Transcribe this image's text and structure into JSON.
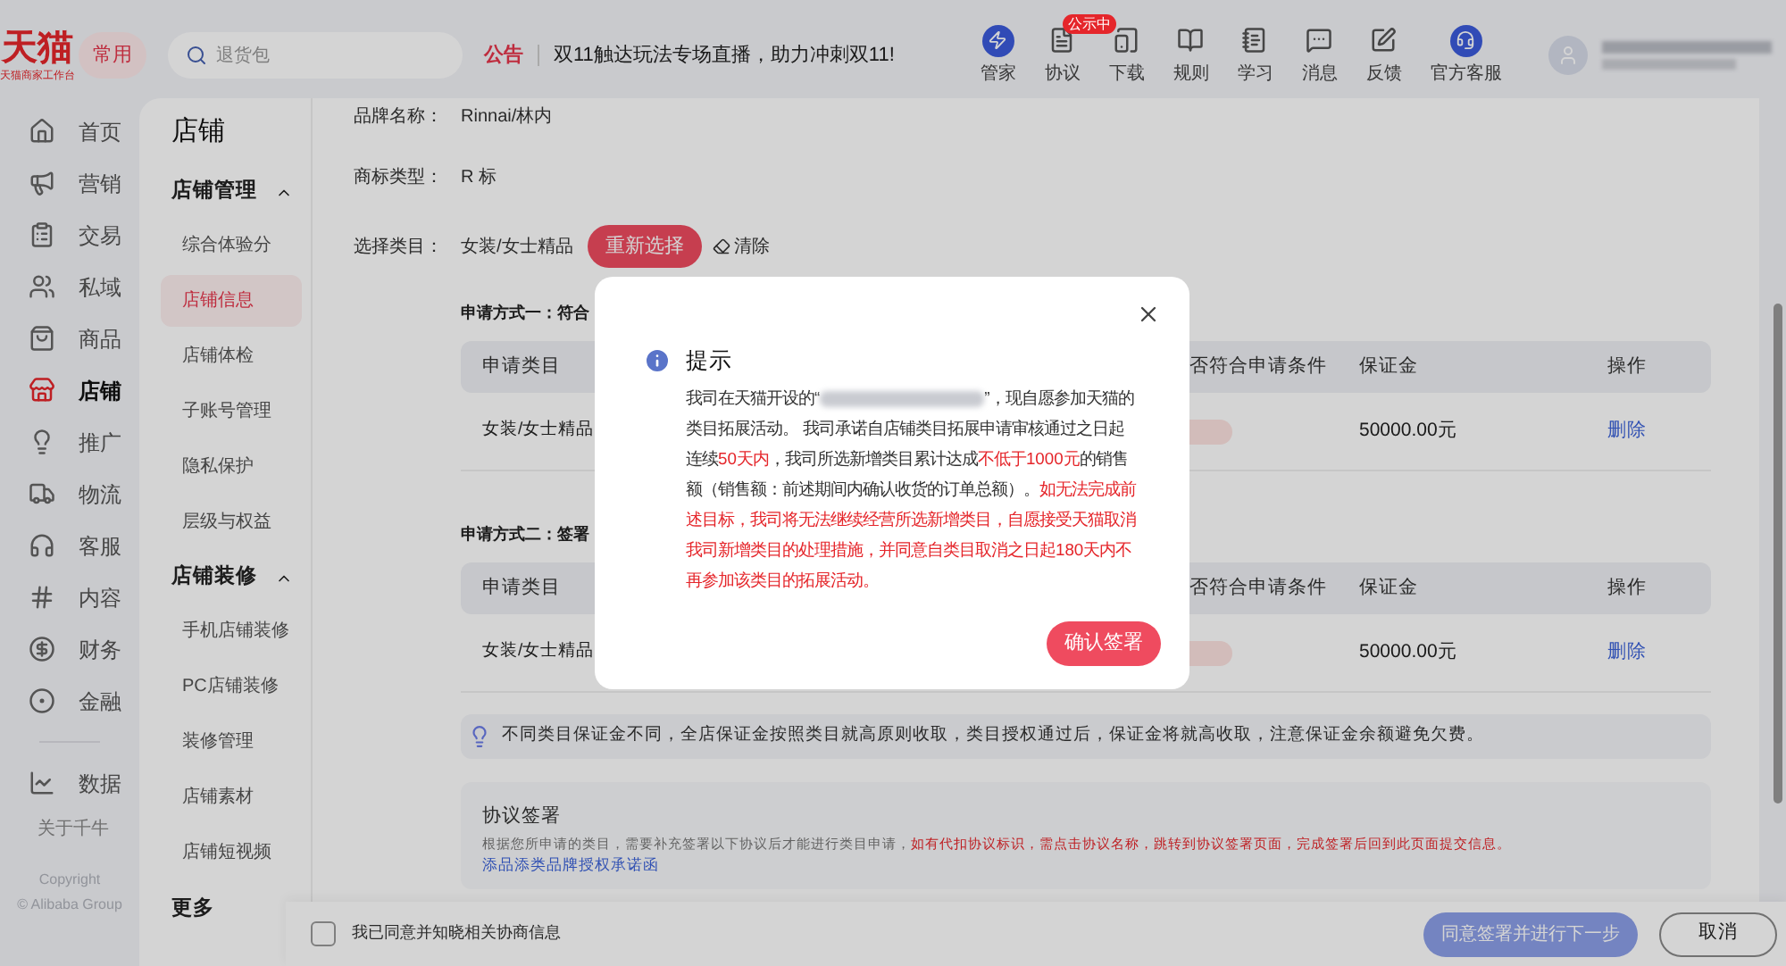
{
  "header": {
    "logo": {
      "title": "天猫",
      "subtitle": "天猫商家工作台"
    },
    "favorites_button": "常用",
    "search": {
      "placeholder": "退货包"
    },
    "announcement": {
      "label": "公告",
      "text": "双11触达玩法专场直播，助力冲刺双11!"
    },
    "tools": [
      {
        "label": "管家"
      },
      {
        "label": "协议",
        "badge": "公示中"
      },
      {
        "label": "下载"
      },
      {
        "label": "规则"
      },
      {
        "label": "学习"
      },
      {
        "label": "消息"
      },
      {
        "label": "反馈"
      },
      {
        "label": "官方客服"
      }
    ]
  },
  "nav": {
    "items": [
      {
        "label": "首页",
        "selected": false
      },
      {
        "label": "营销",
        "selected": false
      },
      {
        "label": "交易",
        "selected": false
      },
      {
        "label": "私域",
        "selected": false
      },
      {
        "label": "商品",
        "selected": false
      },
      {
        "label": "店铺",
        "selected": true
      },
      {
        "label": "推广",
        "selected": false
      },
      {
        "label": "物流",
        "selected": false
      },
      {
        "label": "客服",
        "selected": false
      },
      {
        "label": "内容",
        "selected": false
      },
      {
        "label": "财务",
        "selected": false
      },
      {
        "label": "金融",
        "selected": false
      },
      {
        "label": "数据",
        "selected": false
      }
    ],
    "about": "关于千牛",
    "copyright": [
      "Copyright",
      "© Alibaba Group"
    ]
  },
  "sidebar": {
    "title": "店铺",
    "groups": [
      {
        "label": "店铺管理",
        "expanded": true,
        "items": [
          {
            "label": "综合体验分",
            "selected": false
          },
          {
            "label": "店铺信息",
            "selected": true
          },
          {
            "label": "店铺体检",
            "selected": false
          },
          {
            "label": "子账号管理",
            "selected": false
          },
          {
            "label": "隐私保护",
            "selected": false
          },
          {
            "label": "层级与权益",
            "selected": false
          }
        ]
      },
      {
        "label": "店铺装修",
        "expanded": true,
        "items": [
          {
            "label": "手机店铺装修",
            "selected": false
          },
          {
            "label": "PC店铺装修",
            "selected": false
          },
          {
            "label": "装修管理",
            "selected": false
          },
          {
            "label": "店铺素材",
            "selected": false
          },
          {
            "label": "店铺短视频",
            "selected": false
          }
        ]
      }
    ],
    "more": "更多"
  },
  "form": {
    "fields": [
      {
        "label": "品牌名称：",
        "value": "Rinnai/林内"
      },
      {
        "label": "商标类型：",
        "value": "R 标"
      }
    ],
    "category": {
      "label": "选择类目：",
      "value": "女装/女士精品",
      "reselect": "重新选择",
      "clear": "清除"
    }
  },
  "methods": [
    {
      "title": "申请方式一：符合",
      "columns": [
        "申请类目",
        "否符合申请条件",
        "保证金",
        "操作"
      ],
      "rows": [
        {
          "category": "女装/女士精品",
          "deposit": "50000.00元",
          "action": "删除"
        }
      ]
    },
    {
      "title": "申请方式二：签署",
      "columns": [
        "申请类目",
        "否符合申请条件",
        "保证金",
        "操作"
      ],
      "rows": [
        {
          "category": "女装/女士精品",
          "deposit": "50000.00元",
          "action": "删除"
        }
      ]
    }
  ],
  "notice": "不同类目保证金不同，全店保证金按照类目就高原则收取，类目授权通过后，保证金将就高收取，注意保证金余额避免欠费。",
  "agreement": {
    "title": "协议签署",
    "description": [
      {
        "kind": "text",
        "text": "根据您所申请的类目，需要补充签署以下协议后才能进行类目申请，"
      },
      {
        "kind": "highlight",
        "text": "如有代扣协议标识，需点击协议名称，跳转到协议签署页面，完成签署后回到此页面提交信息。"
      }
    ],
    "link": "添品添类品牌授权承诺函"
  },
  "footer": {
    "consent": {
      "label": "我已同意并知晓相关协商信息",
      "checked": false
    },
    "primary": "同意签署并进行下一步",
    "cancel": "取消"
  },
  "dialog": {
    "title": "提示",
    "body": [
      {
        "kind": "text",
        "text": "我司在天猫开设的“"
      },
      {
        "kind": "redacted"
      },
      {
        "kind": "text",
        "text": "”，现自愿参加天猫的类目拓展活动。 我司承诺自店铺类目拓展申请审核通过之日起连续"
      },
      {
        "kind": "highlight",
        "text": "50天内"
      },
      {
        "kind": "text",
        "text": "，我司所选新增类目累计达成"
      },
      {
        "kind": "highlight",
        "text": "不低于1000元"
      },
      {
        "kind": "text",
        "text": "的销售额（销售额：前述期间内确认收货的订单总额）。"
      },
      {
        "kind": "highlight",
        "text": "如无法完成前述目标，我司将无法继续经营所选新增类目，自愿接受天猫取消我司新增类目的处理措施，并同意自类目取消之日起180天内不再参加该类目的拓展活动。"
      }
    ],
    "confirm": "确认签署"
  }
}
